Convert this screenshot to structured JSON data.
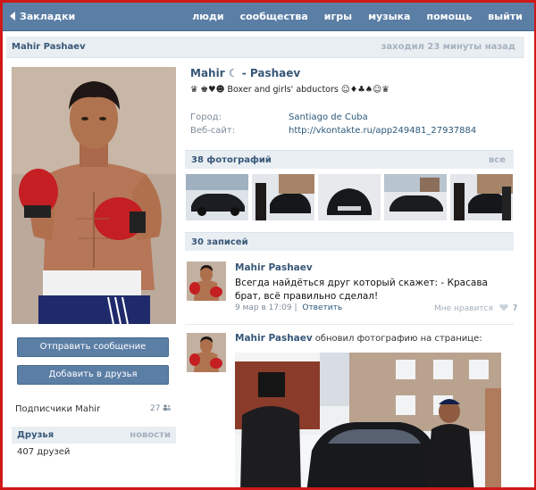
{
  "header": {
    "bookmarks_label": "Закладки",
    "nav": [
      "люди",
      "сообщества",
      "игры",
      "музыка",
      "помощь",
      "выйти"
    ]
  },
  "profile": {
    "header_name": "Mahir Pashaev",
    "last_seen": "заходил 23 минуты назад",
    "display_name": "Mahir ☾ -  Pashaev",
    "status": "♛ ♚♥☻ Boxer and girls' abductors ☺♦♣♠☺♛",
    "info": [
      {
        "label": "Город:",
        "value": "Santiago de Cuba"
      },
      {
        "label": "Веб-сайт:",
        "value": "http://vkontakte.ru/app249481_27937884"
      }
    ],
    "send_message": "Отправить сообщение",
    "add_friend": "Добавить в друзья",
    "subscribers_label": "Подписчики Mahir",
    "subscribers_count": "27",
    "friends_title": "Друзья",
    "friends_news": "новости",
    "friends_count": "407 друзей"
  },
  "photos": {
    "title": "38 фотографий",
    "all_label": "все"
  },
  "posts": {
    "title": "30 записей",
    "items": [
      {
        "author": "Mahir Pashaev",
        "text": "Всегда найдёться друг который скажет: - Красава брат, всё правильно сделал!",
        "date": "9 мар в 17:09",
        "reply": "Ответить",
        "like_label": "Мне нравится",
        "likes": "7"
      },
      {
        "author": "Mahir Pashaev",
        "action": "обновил фотографию на странице:"
      }
    ]
  },
  "colors": {
    "topbar": "#5b7ea5",
    "link": "#2b587a",
    "name": "#375778",
    "muted": "#7f8c9a",
    "frame": "#d01818"
  }
}
